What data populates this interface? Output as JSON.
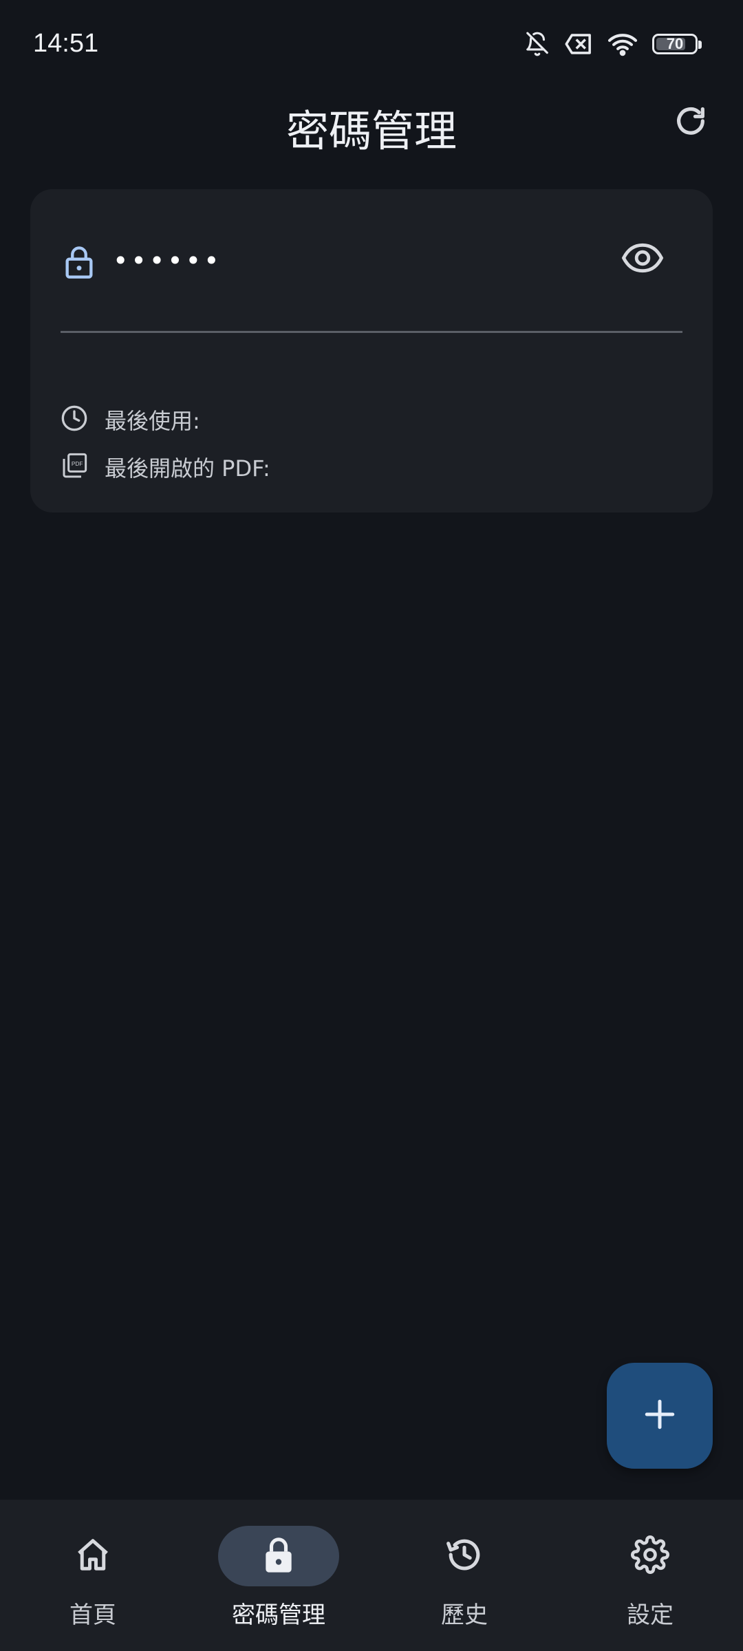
{
  "status_bar": {
    "time": "14:51",
    "battery_level": "70",
    "icons": [
      "bell-off-icon",
      "no-sim-icon",
      "wifi-icon",
      "battery-icon"
    ]
  },
  "app_bar": {
    "title": "密碼管理",
    "refresh_icon": "refresh-icon"
  },
  "password_card": {
    "lock_icon": "lock-icon",
    "masked_value": "••••••",
    "toggle_icon": "eye-icon",
    "last_used_label": "最後使用:",
    "last_used_icon": "clock-icon",
    "last_pdf_label": "最後開啟的 PDF:",
    "last_pdf_icon": "pdf-icon"
  },
  "fab": {
    "icon": "plus-icon"
  },
  "bottom_nav": {
    "items": [
      {
        "label": "首頁",
        "icon": "home-icon",
        "active": false
      },
      {
        "label": "密碼管理",
        "icon": "lock-icon",
        "active": true
      },
      {
        "label": "歷史",
        "icon": "history-icon",
        "active": false
      },
      {
        "label": "設定",
        "icon": "gear-icon",
        "active": false
      }
    ]
  },
  "colors": {
    "background": "#12151b",
    "surface": "#1c1f25",
    "accent_lock": "#a8c8f4",
    "fab": "#1f4d7c",
    "nav_active_pill": "#3a4556"
  }
}
